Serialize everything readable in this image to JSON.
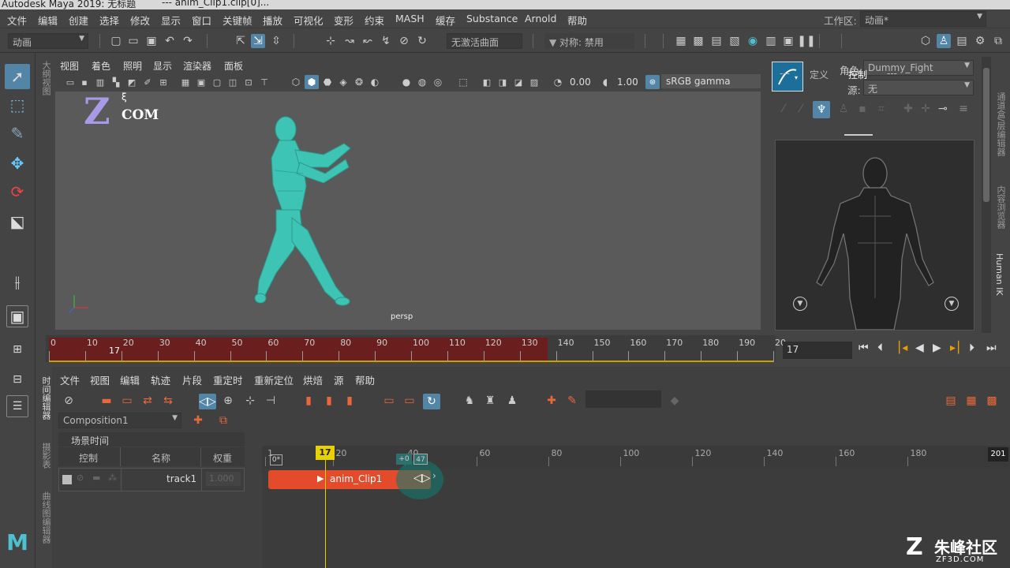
{
  "window": {
    "title_left": "Autodesk Maya 2019: 无标题",
    "title_right": "---   anim_Clip1.clip[0]..."
  },
  "menu": [
    "文件",
    "编辑",
    "创建",
    "选择",
    "修改",
    "显示",
    "窗口",
    "关键帧",
    "播放",
    "可视化",
    "变形",
    "约束",
    "MASH",
    "缓存",
    "Substance",
    "Arnold",
    "帮助"
  ],
  "workspace": {
    "label": "工作区:",
    "value": "动画*"
  },
  "status": {
    "mode": "动画",
    "live_surface": "无激活曲面",
    "symmetry": "对称: 禁用"
  },
  "viewport": {
    "menu": [
      "视图",
      "着色",
      "照明",
      "显示",
      "渲染器",
      "面板"
    ],
    "exposure": "0.00",
    "gamma": "1.00",
    "color_space": "sRGB gamma",
    "camera": "persp",
    "watermark_z": "Z",
    "watermark_com": "COM",
    "side_label": "大纲视图"
  },
  "timeslider": {
    "ticks": [
      "0",
      "10",
      "20",
      "30",
      "40",
      "50",
      "60",
      "70",
      "80",
      "90",
      "100",
      "110",
      "120",
      "130",
      "140",
      "150",
      "160",
      "170",
      "180",
      "190",
      "20"
    ],
    "current": "17",
    "frame_field": "17"
  },
  "hik": {
    "character_label": "角色:",
    "character": "Dummy_Fight",
    "source_label": "源:",
    "source": "无",
    "tabs": [
      "---",
      "定义",
      "控制",
      "---"
    ],
    "active_tab": "控制"
  },
  "right_strip": [
    "通道盒/层编辑器",
    "内容浏览器",
    "Human IK"
  ],
  "editor": {
    "menu": [
      "文件",
      "视图",
      "编辑",
      "轨迹",
      "片段",
      "重定时",
      "重新定位",
      "烘焙",
      "源",
      "帮助"
    ],
    "composition": "Composition1",
    "scene_time": "场景时间",
    "columns": [
      "控制",
      "名称",
      "权重"
    ],
    "track_name": "track1",
    "track_weight": "1.000",
    "side_labels": [
      "时间编辑器",
      "摄影表",
      "曲线图编辑器"
    ],
    "ruler": [
      "1",
      "20",
      "40",
      "60",
      "80",
      "100",
      "120",
      "140",
      "160",
      "180",
      "201"
    ],
    "start_badge": "0*",
    "playhead": "17",
    "offset_badge": "+0",
    "end_badge": "47",
    "clip_name": "anim_Clip1"
  },
  "logo": {
    "main": "朱峰社区",
    "sub": "ZF3D.COM"
  },
  "colors": {
    "accent": "#5285a6",
    "clip": "#e34b2b",
    "playhead": "#e8d100",
    "character": "#3ec4b4"
  }
}
